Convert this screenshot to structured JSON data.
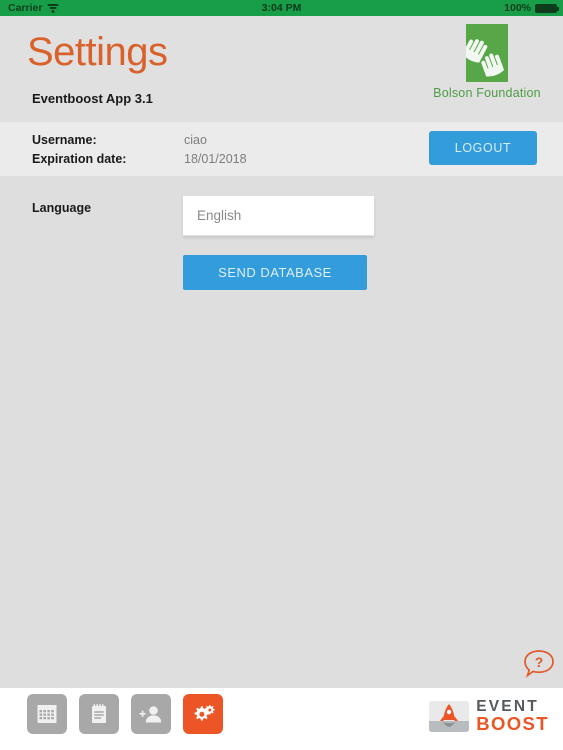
{
  "statusbar": {
    "carrier": "Carrier",
    "wifi_icon": "wifi-icon",
    "time": "3:04 PM",
    "battery_percent": "100%",
    "battery_icon": "battery-full-icon",
    "background_color": "#189e48"
  },
  "header": {
    "title": "Settings",
    "title_color": "#d9622c",
    "app_version": "Eventboost App 3.1",
    "brand": {
      "name": "Bolson Foundation",
      "mark_icon": "two-hands-icon",
      "color": "#57a749"
    }
  },
  "account": {
    "username_label": "Username:",
    "username_value": "ciao",
    "expiration_label": "Expiration date:",
    "expiration_value": "18/01/2018",
    "logout_label": "LOGOUT",
    "accent_color": "#339cdb"
  },
  "settings": {
    "language_label": "Language",
    "language_value": "English",
    "language_placeholder": "English",
    "send_database_label": "SEND DATABASE"
  },
  "help": {
    "icon": "question-speech-bubble-icon",
    "label": "?",
    "color": "#e05a2b"
  },
  "toolbar": {
    "items": [
      {
        "name": "calendar-icon",
        "label": "",
        "active": false
      },
      {
        "name": "notepad-icon",
        "label": "",
        "active": false
      },
      {
        "name": "add-person-icon",
        "label": "",
        "active": false
      },
      {
        "name": "gear-icon",
        "label": "",
        "active": true
      }
    ],
    "active_color": "#ec5526",
    "inactive_color": "#a8a8a8",
    "logo": {
      "icon": "rocket-icon",
      "line1": "EVENT",
      "line2": "BOOST",
      "line1_color": "#555a5e",
      "line2_color": "#ec5526"
    }
  }
}
